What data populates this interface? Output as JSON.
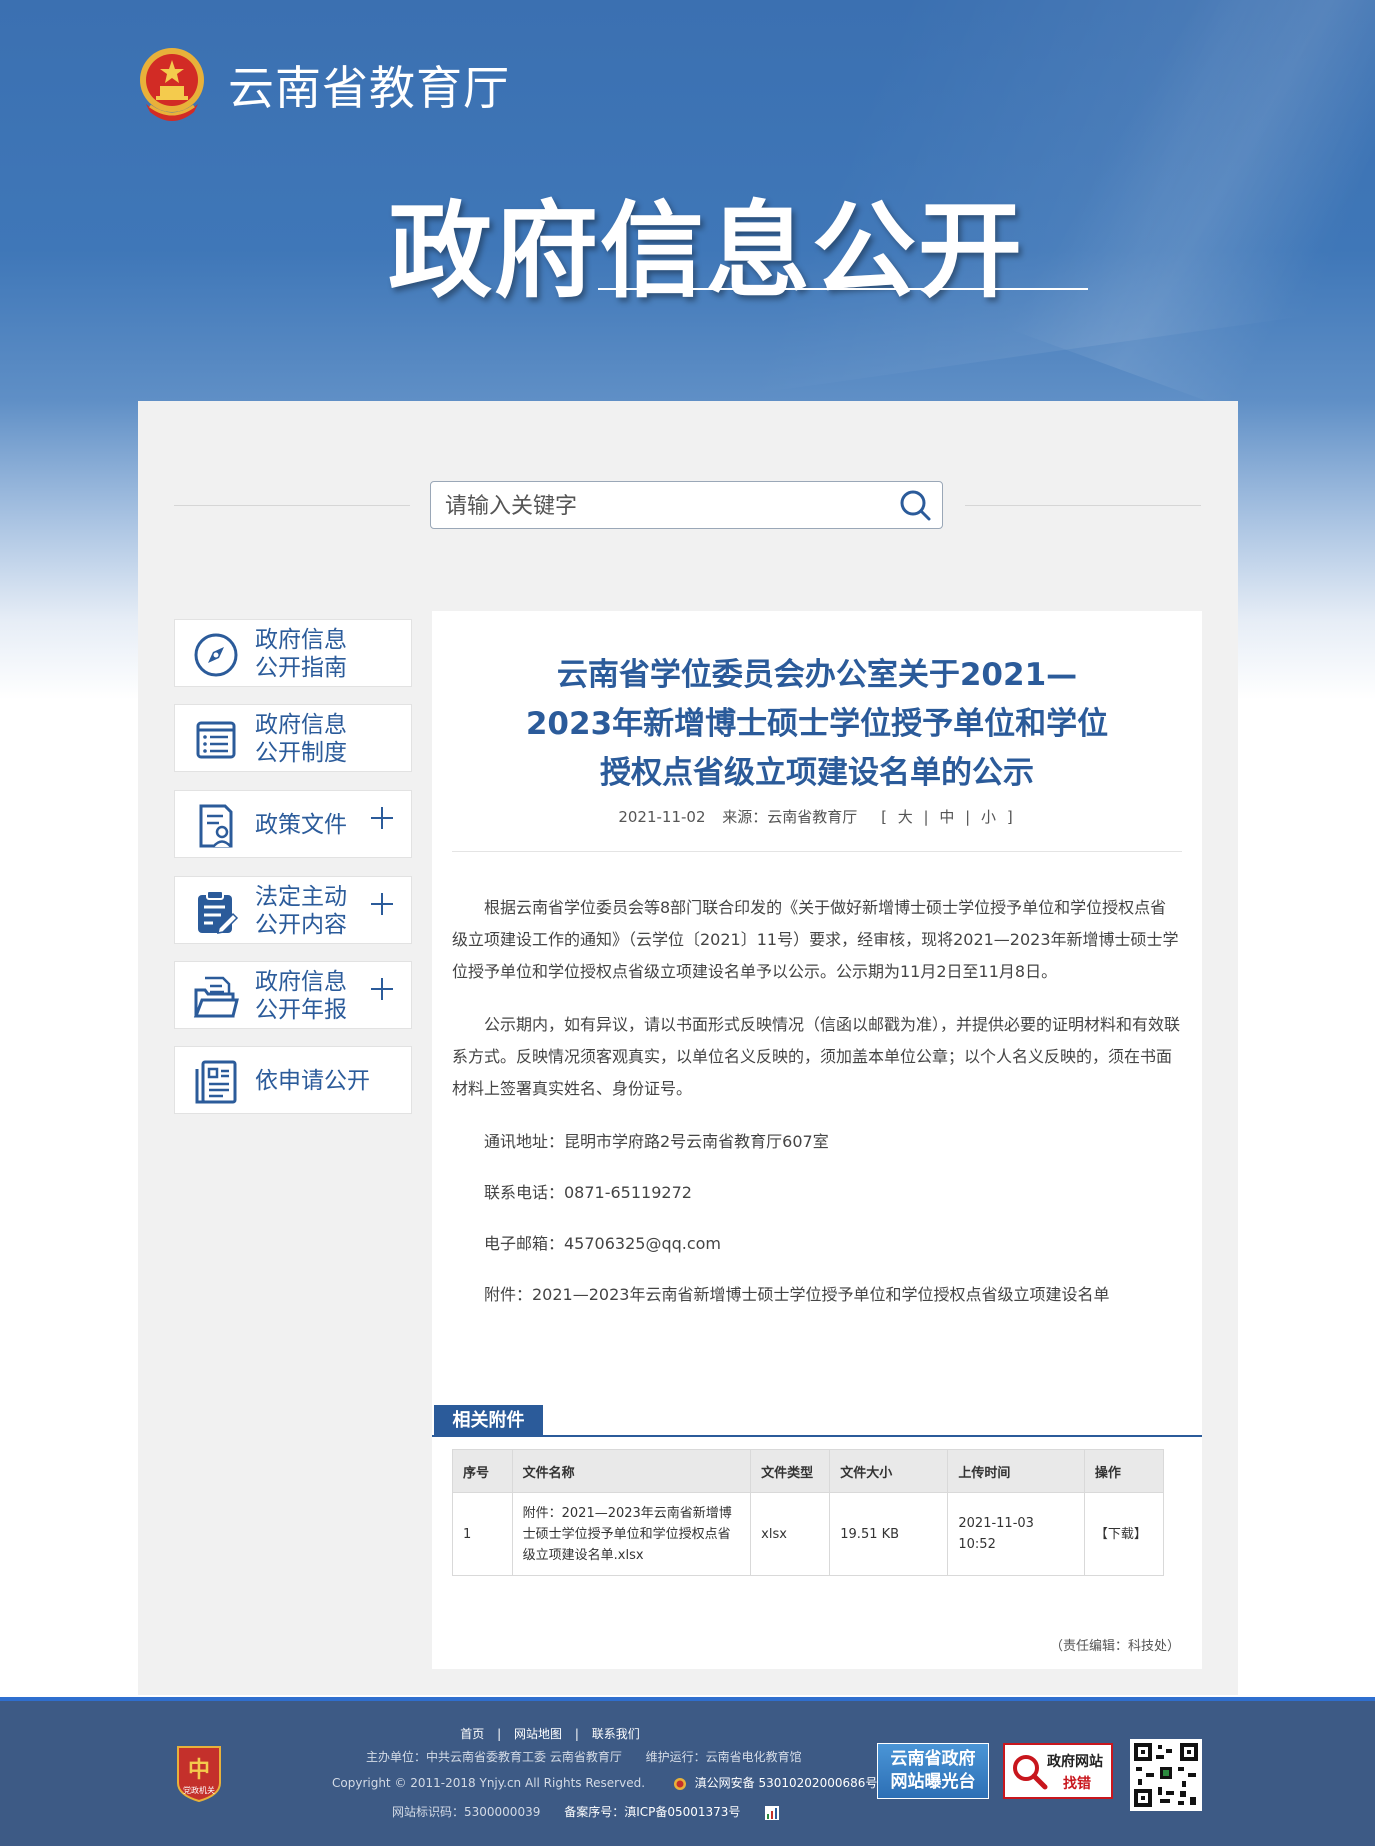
{
  "header": {
    "org_name": "云南省教育厅",
    "banner": "政府信息公开"
  },
  "search": {
    "placeholder": "请输入关键字"
  },
  "sidebar": {
    "items": [
      {
        "label": "政府信息公开指南",
        "icon": "compass-icon",
        "expandable": false
      },
      {
        "label": "政府信息公开制度",
        "icon": "list-icon",
        "expandable": false
      },
      {
        "label": "政策文件",
        "icon": "document-user-icon",
        "expandable": true
      },
      {
        "label": "法定主动公开内容",
        "icon": "clipboard-edit-icon",
        "expandable": true
      },
      {
        "label": "政府信息公开年报",
        "icon": "folder-icon",
        "expandable": true
      },
      {
        "label": "依申请公开",
        "icon": "form-icon",
        "expandable": false
      }
    ]
  },
  "article": {
    "title_lines": [
      "云南省学位委员会办公室关于2021—",
      "2023年新增博士硕士学位授予单位和学位",
      "授权点省级立项建设名单的公示"
    ],
    "date": "2021-11-02",
    "source": "来源：云南省教育厅",
    "font_size": {
      "open": "[",
      "large": "大",
      "medium": "中",
      "small": "小",
      "close": "]",
      "sep": "|"
    },
    "paragraphs": [
      "根据云南省学位委员会等8部门联合印发的《关于做好新增博士硕士学位授予单位和学位授权点省级立项建设工作的通知》（云学位〔2021〕11号）要求，经审核，现将2021—2023年新增博士硕士学位授予单位和学位授权点省级立项建设名单予以公示。公示期为11月2日至11月8日。",
      "公示期内，如有异议，请以书面形式反映情况（信函以邮戳为准），并提供必要的证明材料和有效联系方式。反映情况须客观真实，以单位名义反映的，须加盖本单位公章；以个人名义反映的，须在书面材料上签署真实姓名、身份证号。",
      "通讯地址：昆明市学府路2号云南省教育厅607室",
      "联系电话：0871-65119272",
      "电子邮箱：45706325@qq.com",
      "附件：2021—2023年云南省新增博士硕士学位授予单位和学位授权点省级立项建设名单"
    ],
    "editor": "（责任编辑：科技处）"
  },
  "attachments": {
    "tab_label": "相关附件",
    "columns": [
      "序号",
      "文件名称",
      "文件类型",
      "文件大小",
      "上传时间",
      "操作"
    ],
    "rows": [
      {
        "index": "1",
        "name": "附件：2021—2023年云南省新增博士硕士学位授予单位和学位授权点省级立项建设名单.xlsx",
        "type": "xlsx",
        "size": "19.51 KB",
        "uploaded": "2021-11-03 10:52",
        "action": "【下载】"
      }
    ]
  },
  "footer": {
    "links": [
      "首页",
      "网站地图",
      "联系我们"
    ],
    "link_sep": "|",
    "sponsor": "主办单位：中共云南省委教育工委 云南省教育厅",
    "maintainer": "维护运行：云南省电化教育馆",
    "copyright": "Copyright © 2011-2018 Ynjy.cn All Rights Reserved.",
    "police_record": "滇公网安备 53010202000686号",
    "site_id": "网站标识码：5300000039",
    "icp": "备案序号：滇ICP备05001373号",
    "badge1_lines": [
      "云南省政府",
      "网站曝光台"
    ],
    "badge2_line1": "政府网站",
    "badge2_line2": "找错",
    "emblem_text": "党政机关"
  },
  "colors": {
    "primary_blue": "#2b5b9a",
    "header_blue": "#3b70b1",
    "footer_bg": "#3d5a85",
    "accent_red": "#c8161d"
  }
}
